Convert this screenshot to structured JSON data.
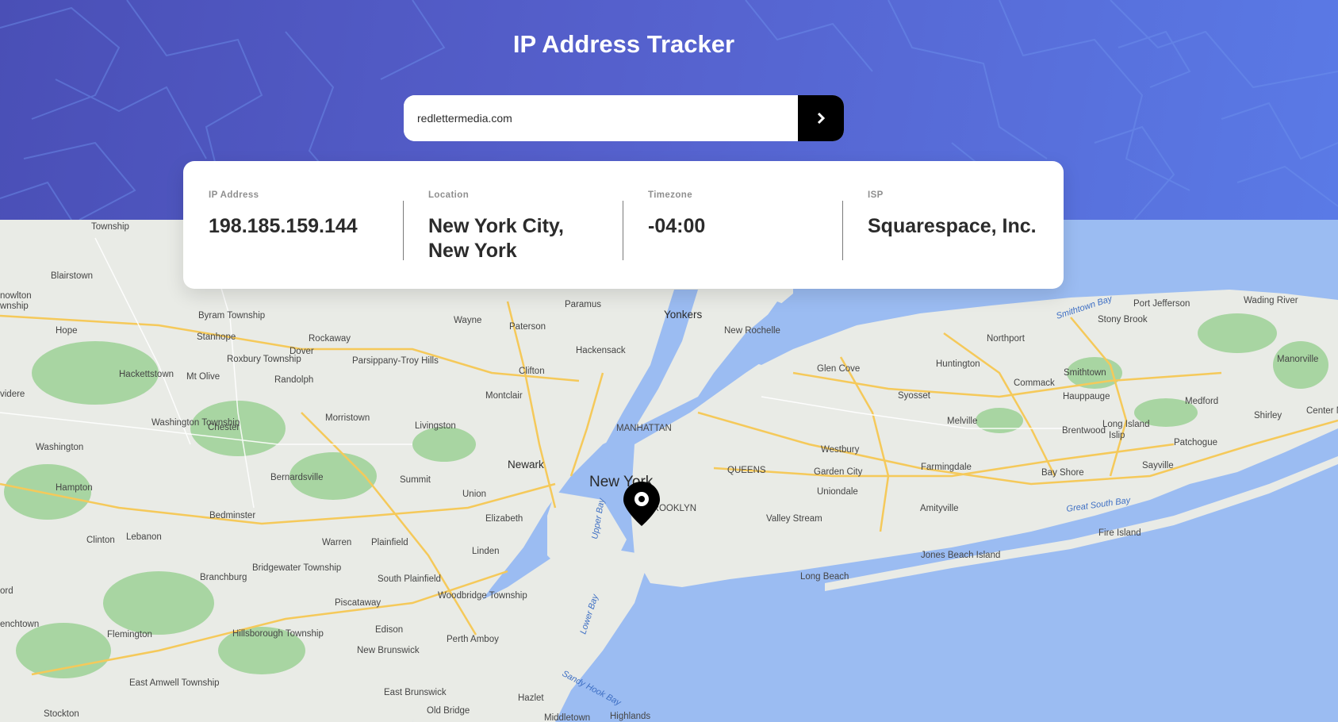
{
  "app": {
    "title": "IP Address Tracker"
  },
  "search": {
    "value": "redlettermedia.com",
    "submit_icon": "chevron-right-icon"
  },
  "info": {
    "ip_label": "IP Address",
    "ip_value": "198.185.159.144",
    "location_label": "Location",
    "location_value": "New York City, New York",
    "timezone_label": "Timezone",
    "timezone_value": "-04:00",
    "isp_label": "ISP",
    "isp_value": "Squarespace, Inc."
  },
  "map": {
    "marker_icon": "location-pin-icon",
    "colors": {
      "land": "#e9ebe6",
      "water": "#9bbcf2",
      "parks": "#a8d5a2",
      "highway": "#f5c95a"
    },
    "places": [
      "Township",
      "Blairstown",
      "nowlton",
      "wnship",
      "Hope",
      "Byram Township",
      "Stanhope",
      "Rockaway",
      "Roxbury Township",
      "Dover",
      "Hackettstown",
      "Mt Olive",
      "Parsippany-Troy Hills",
      "Randolph",
      "Clifton",
      "Montclair",
      "Morristown",
      "Livingston",
      "Washington Township",
      "Chester",
      "Washington",
      "videre",
      "Hampton",
      "Bernardsville",
      "Bedminster",
      "Clinton",
      "Lebanon",
      "Warren",
      "Plainfield",
      "Summit",
      "Union",
      "Elizabeth",
      "Linden",
      "Bridgewater Township",
      "Branchburg",
      "South Plainfield",
      "Piscataway",
      "Woodbridge Township",
      "Edison",
      "Perth Amboy",
      "Hillsborough Township",
      "Flemington",
      "New Brunswick",
      "East Amwell Township",
      "enchtown",
      "ord",
      "Stockton",
      "East Brunswick",
      "Old Bridge",
      "Hazlet",
      "Middletown",
      "Highlands",
      "Paramus",
      "Wayne",
      "Paterson",
      "Hackensack",
      "Yonkers",
      "New Rochelle",
      "MANHATTAN",
      "Newark",
      "New York",
      "BROOKLYN",
      "QUEENS",
      "Glen Cove",
      "Huntington",
      "Northport",
      "Syosset",
      "Melville",
      "Westbury",
      "Garden City",
      "Uniondale",
      "Farmingdale",
      "Valley Stream",
      "Amityville",
      "Long Beach",
      "Jones Beach Island",
      "Commack",
      "Smithtown",
      "Hauppauge",
      "Brentwood",
      "Bay Shore",
      "Islip",
      "Long Island",
      "Patchogue",
      "Sayville",
      "Fire Island",
      "Medford",
      "Shirley",
      "Stony Brook",
      "Port Jefferson",
      "Wading River",
      "Manorville",
      "Center Moriches"
    ],
    "water_labels": [
      "Smithtown Bay",
      "Great South Bay",
      "Upper Bay",
      "Lower Bay",
      "Sandy Hook Bay"
    ]
  }
}
